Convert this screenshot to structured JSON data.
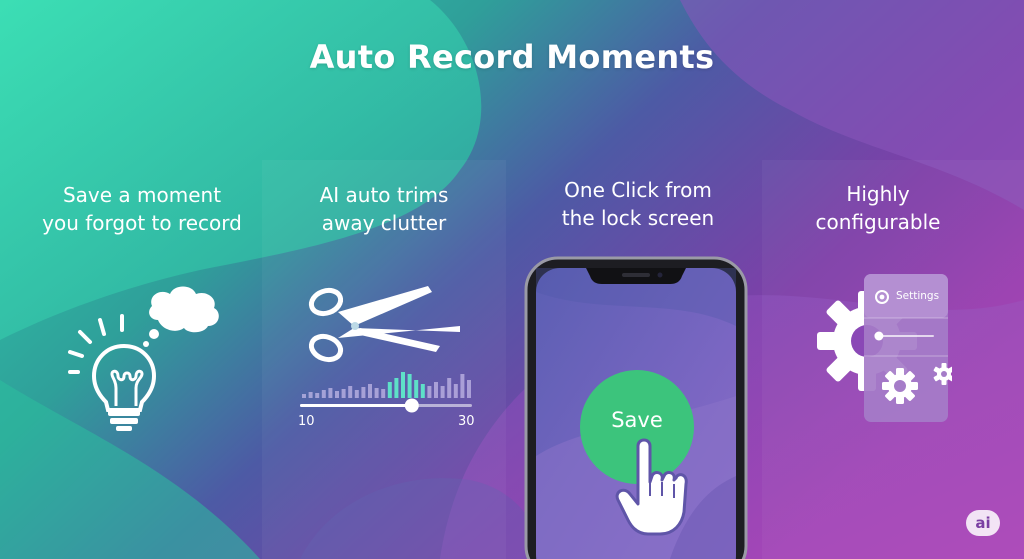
{
  "slide": {
    "title": "Auto Record Moments"
  },
  "features": [
    {
      "caption": "Save a moment\nyou forgot to record",
      "icon": "lightbulb-thought-icon"
    },
    {
      "caption": "AI auto trims\naway clutter",
      "icon": "scissors-icon"
    },
    {
      "caption": "One Click from\nthe lock screen",
      "icon": "phone-tap-icon"
    },
    {
      "caption": "Highly\nconfigurable",
      "icon": "gear-settings-icon"
    }
  ],
  "trim_widget": {
    "min_label": "10",
    "max_label": "30",
    "handle_position": 0.65
  },
  "phone": {
    "save_button_label": "Save"
  },
  "settings_card": {
    "label": "Settings",
    "slider_level": 0.05
  },
  "badge": {
    "label": "ai"
  },
  "colors": {
    "teal": "#2fd3a8",
    "purple": "#6b3fa0",
    "magenta": "#a23cb0",
    "save_button": "#3cc47c"
  }
}
